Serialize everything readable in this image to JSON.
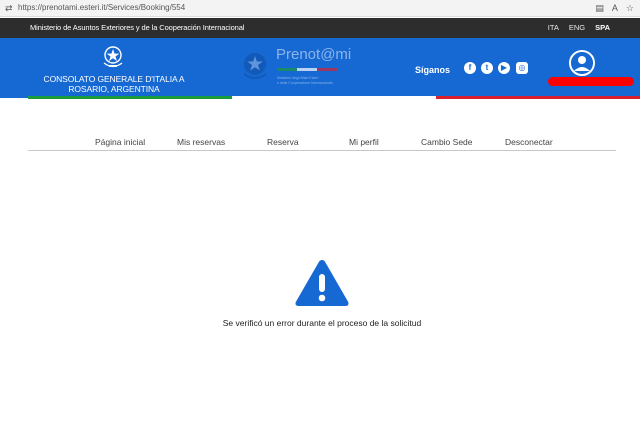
{
  "browser": {
    "url": "https://prenotami.esteri.it/Services/Booking/554"
  },
  "top_strip": {
    "ministry": "Ministerio de Asuntos Exteriores y de la Cooperación Internacional",
    "languages": [
      {
        "label": "ITA",
        "active": false
      },
      {
        "label": "ENG",
        "active": false
      },
      {
        "label": "SPA",
        "active": true
      }
    ]
  },
  "header": {
    "consulate_line1": "CONSOLATO GENERALE D'ITALIA A",
    "consulate_line2": "ROSARIO, ARGENTINA",
    "logo_text": "Prenot@mi",
    "logo_sub_line1": "Ministero degli Affari Esteri",
    "logo_sub_line2": "e della Cooperazione Internazionale",
    "follow_label": "Síganos",
    "social_icons": [
      "facebook-icon",
      "twitter-icon",
      "youtube-icon",
      "instagram-icon"
    ],
    "colors": {
      "blue": "#1668d3",
      "redaction": "#ff0000"
    }
  },
  "tricolore": [
    "#1a9b3c",
    "#ffffff",
    "#d9212e"
  ],
  "nav": {
    "items": [
      "Página inicial",
      "Mis reservas",
      "Reserva",
      "Mi perfil",
      "Cambio Sede",
      "Desconectar"
    ]
  },
  "error": {
    "icon": "warning-icon",
    "icon_color": "#1668d3",
    "message": "Se verificó un error durante el proceso de la solicitud"
  }
}
